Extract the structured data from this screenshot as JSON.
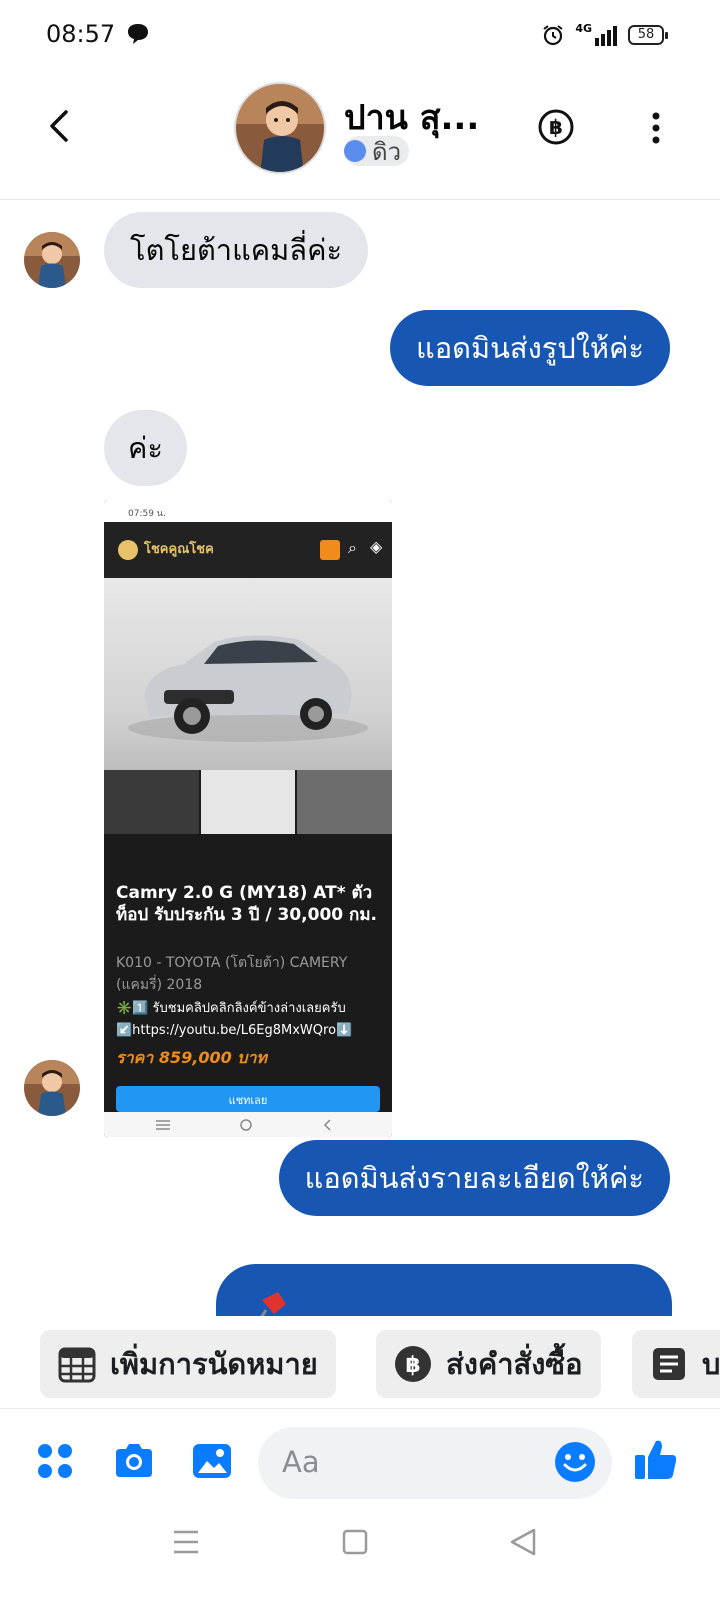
{
  "status_bar": {
    "time": "08:57",
    "network": "4G",
    "battery": "58"
  },
  "header": {
    "contact_name": "ปาน สุ...",
    "presence_label": "ดิว"
  },
  "messages": [
    {
      "direction": "incoming",
      "text": "โตโยต้าแคมลี่ค่ะ"
    },
    {
      "direction": "outgoing",
      "text": "แอดมินส่งรูปให้ค่ะ"
    },
    {
      "direction": "incoming",
      "text": "ค่ะ"
    },
    {
      "direction": "outgoing",
      "text": "แอดมินส่งรายละเอียดให้ค่ะ"
    }
  ],
  "shared_image": {
    "status_time": "07:59 น.",
    "site_name": "โชคคูณโชค",
    "listing_title": "Camry 2.0 G (MY18) AT* ตัวท็อป รับประกัน 3 ปี / 30,000 กม.",
    "listing_sub": "K010 - TOYOTA (โตโยต้า) CAMERY (แคมรี่) 2018",
    "note": "✳️1️⃣ รับชมคลิปคลิกลิงค์ข้างล่างเลยครับ",
    "link": "↙️https://youtu.be/L6Eg8MxWQro⬇️",
    "price": "ราคา 859,000 บาท",
    "cta": "แชทเลย"
  },
  "quick_actions": [
    {
      "label": "เพิ่มการนัดหมาย",
      "icon": "calendar-icon"
    },
    {
      "label": "ส่งคำสั่งซื้อ",
      "icon": "baht-icon"
    },
    {
      "label": "บ",
      "icon": "document-icon"
    }
  ],
  "composer": {
    "placeholder": "Aa"
  },
  "colors": {
    "outgoing_bubble": "#1856b4",
    "incoming_bubble": "#e4e6eb",
    "accent": "#0a7cff"
  }
}
